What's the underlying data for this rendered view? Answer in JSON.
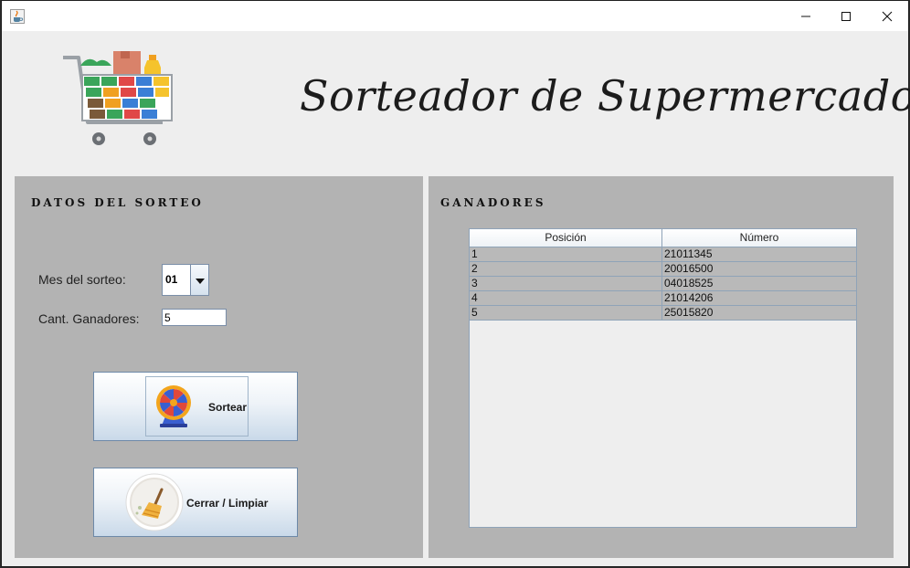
{
  "window": {
    "icon": "java-cup-icon",
    "controls": [
      "minimize-icon",
      "maximize-icon",
      "close-icon"
    ]
  },
  "header": {
    "title": "Sorteador de Supermercado",
    "logo": "shopping-cart-icon"
  },
  "draw_panel": {
    "heading": "DATOS DEL SORTEO",
    "month_label": "Mes del sorteo:",
    "month_value": "01",
    "winners_label": "Cant. Ganadores:",
    "winners_value": "5",
    "draw_button": {
      "label": "Sortear",
      "icon": "prize-wheel-icon"
    },
    "clear_button": {
      "label": "Cerrar / Limpiar",
      "icon": "broom-icon"
    }
  },
  "winners_panel": {
    "heading": "GANADORES",
    "columns": [
      "Posición",
      "Número"
    ],
    "rows": [
      [
        "1",
        "21011345"
      ],
      [
        "2",
        "20016500"
      ],
      [
        "3",
        "04018525"
      ],
      [
        "4",
        "21014206"
      ],
      [
        "5",
        "25015820"
      ]
    ]
  },
  "colors": {
    "panel": "#b3b3b3",
    "window_bg": "#eeeeee",
    "button_border": "#6d89a8",
    "row_bg": "#b9b9b9"
  }
}
